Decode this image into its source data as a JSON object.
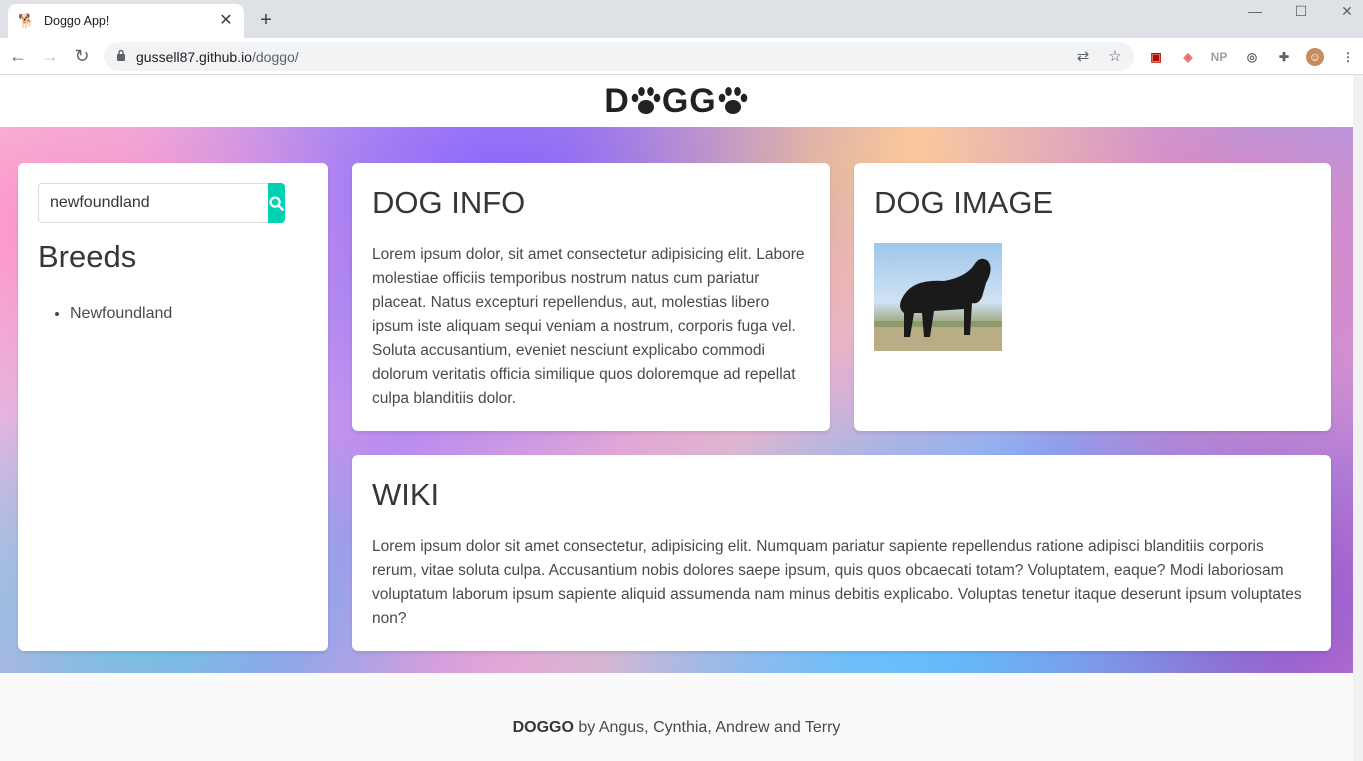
{
  "browser": {
    "tab_title": "Doggo App!",
    "url_host": "gussell87.github.io",
    "url_path": "/doggo/"
  },
  "site": {
    "logo_left": "D",
    "logo_mid": "GG"
  },
  "sidebar": {
    "search_value": "newfoundland",
    "heading": "Breeds",
    "breeds": [
      "Newfoundland"
    ]
  },
  "info": {
    "heading": "DOG INFO",
    "text": "Lorem ipsum dolor, sit amet consectetur adipisicing elit. Labore molestiae officiis temporibus nostrum natus cum pariatur placeat. Natus excepturi repellendus, aut, molestias libero ipsum iste aliquam sequi veniam a nostrum, corporis fuga vel. Soluta accusantium, eveniet nesciunt explicabo commodi dolorum veritatis officia similique quos doloremque ad repellat culpa blanditiis dolor."
  },
  "image_card": {
    "heading": "DOG IMAGE"
  },
  "wiki": {
    "heading": "WIKI",
    "text": "Lorem ipsum dolor sit amet consectetur, adipisicing elit. Numquam pariatur sapiente repellendus ratione adipisci blanditiis corporis rerum, vitae soluta culpa. Accusantium nobis dolores saepe ipsum, quis quos obcaecati totam? Voluptatem, eaque? Modi laboriosam voluptatum laborum ipsum sapiente aliquid assumenda nam minus debitis explicabo. Voluptas tenetur itaque deserunt ipsum voluptates non?"
  },
  "footer": {
    "brand": "DOGGO",
    "credits": " by Angus, Cynthia, Andrew and Terry"
  },
  "colors": {
    "search_button": "#00d1b2"
  }
}
